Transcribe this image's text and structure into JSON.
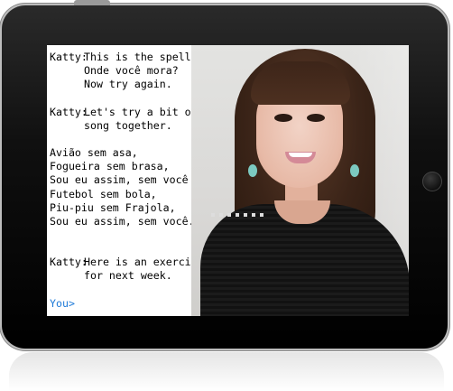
{
  "chat": {
    "messages": [
      {
        "speaker": "Katty:",
        "lines": [
          "This is the spelling,",
          "Onde você mora?",
          "Now try again."
        ]
      },
      {
        "speaker": "Katty:",
        "lines": [
          "Let's try a bit of",
          "song together."
        ]
      }
    ],
    "lyrics": [
      "Avião sem asa,",
      "Fogueira sem brasa,",
      "Sou eu assim, sem você",
      "Futebol sem bola,",
      "Piu-piu sem Frajola,",
      "Sou eu assim, sem você..."
    ],
    "final_message": {
      "speaker": "Katty:",
      "lines": [
        "Here is an exercise",
        "for next week."
      ]
    },
    "prompt": "You>"
  },
  "colors": {
    "prompt": "#1f7bd8",
    "bezel": "#000000"
  },
  "icons": {
    "home_button": "home-button-icon"
  }
}
